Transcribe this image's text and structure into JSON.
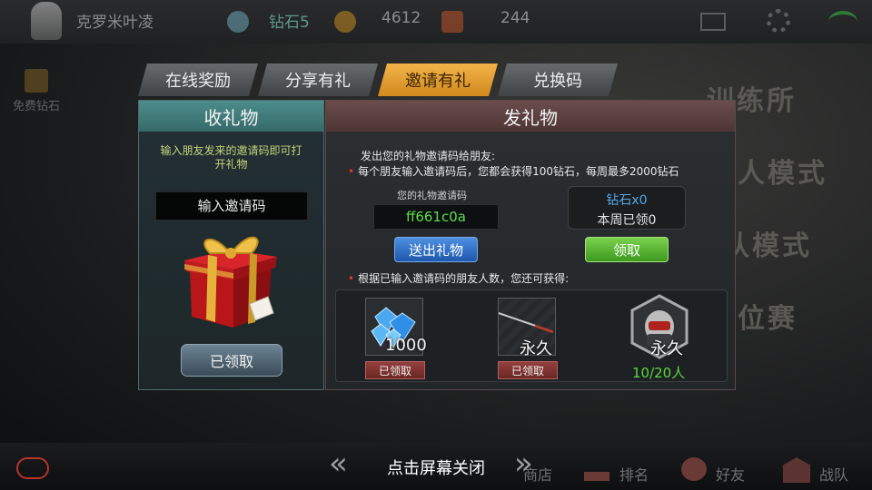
{
  "topbar": {
    "player_name": "克罗米叶凌",
    "rank": "钻石5",
    "coins": "4612",
    "gems": "244"
  },
  "side": {
    "free_diamond": "免费钻石"
  },
  "background_modes": [
    "训练所",
    "人模式",
    "组队模式",
    "位赛"
  ],
  "tabs": [
    {
      "label": "在线奖励"
    },
    {
      "label": "分享有礼"
    },
    {
      "label": "邀请有礼"
    },
    {
      "label": "兑换码"
    }
  ],
  "receive": {
    "title": "收礼物",
    "hint": "输入朋友发来的邀请码即可打开礼物",
    "input_placeholder": "输入邀请码",
    "claimed_button": "已领取"
  },
  "send": {
    "title": "发礼物",
    "intro": "发出您的礼物邀请码给朋友:",
    "rule": "每个朋友输入邀请码后，您都会获得100钻石，每周最多2000钻石",
    "code_label": "您的礼物邀请码",
    "code_value": "ff661c0a",
    "send_button": "送出礼物",
    "reward_line1": "钻石x0",
    "reward_line2": "本周已领0",
    "claim_button": "领取",
    "tier_intro": "根据已输入邀请码的朋友人数，您还可获得:",
    "tiers": [
      {
        "label": "1000",
        "status": "已领取"
      },
      {
        "label": "永久",
        "status": "已领取"
      },
      {
        "label": "永久",
        "status": "10/20人"
      }
    ]
  },
  "bottom": {
    "close_hint": "点击屏幕关闭",
    "shop": "商店",
    "rank": "排名",
    "friends": "好友",
    "clan": "战队"
  },
  "colors": {
    "active_tab": "#e09a2c",
    "left_header": "#428080",
    "right_header": "#5c4140",
    "code_text": "#5fdc4b",
    "progress_text": "#59d63f"
  }
}
